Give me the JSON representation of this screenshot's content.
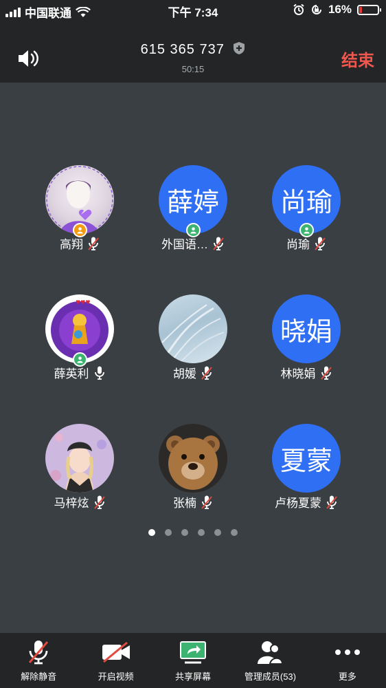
{
  "status_bar": {
    "carrier": "中国联通",
    "time": "下午 7:34",
    "battery": "16%",
    "battery_level": 0.16
  },
  "header": {
    "meeting_id": "615 365 737",
    "duration": "50:15",
    "end_label": "结束"
  },
  "participants": [
    {
      "name": "高翔",
      "avatar_text": "",
      "muted": true
    },
    {
      "name": "外国语…",
      "avatar_text": "薛婷",
      "muted": true
    },
    {
      "name": "尚瑜",
      "avatar_text": "尚瑜",
      "muted": true
    },
    {
      "name": "薛英利",
      "avatar_text": "",
      "muted": false
    },
    {
      "name": "胡媛",
      "avatar_text": "",
      "muted": true
    },
    {
      "name": "林晓娟",
      "avatar_text": "晓娟",
      "muted": true
    },
    {
      "name": "马梓炫",
      "avatar_text": "",
      "muted": true
    },
    {
      "name": "张楠",
      "avatar_text": "",
      "muted": true
    },
    {
      "name": "卢杨夏蒙",
      "avatar_text": "夏蒙",
      "muted": true
    }
  ],
  "pagination": {
    "pages": 6,
    "current": 1
  },
  "toolbar": {
    "unmute_label": "解除静音",
    "video_label": "开启视频",
    "share_label": "共享屏幕",
    "members_label": "管理成员(53)",
    "more_label": "更多"
  },
  "colors": {
    "accent_blue": "#2f6ff4",
    "end_red": "#f0584f",
    "share_green": "#3cb371"
  }
}
